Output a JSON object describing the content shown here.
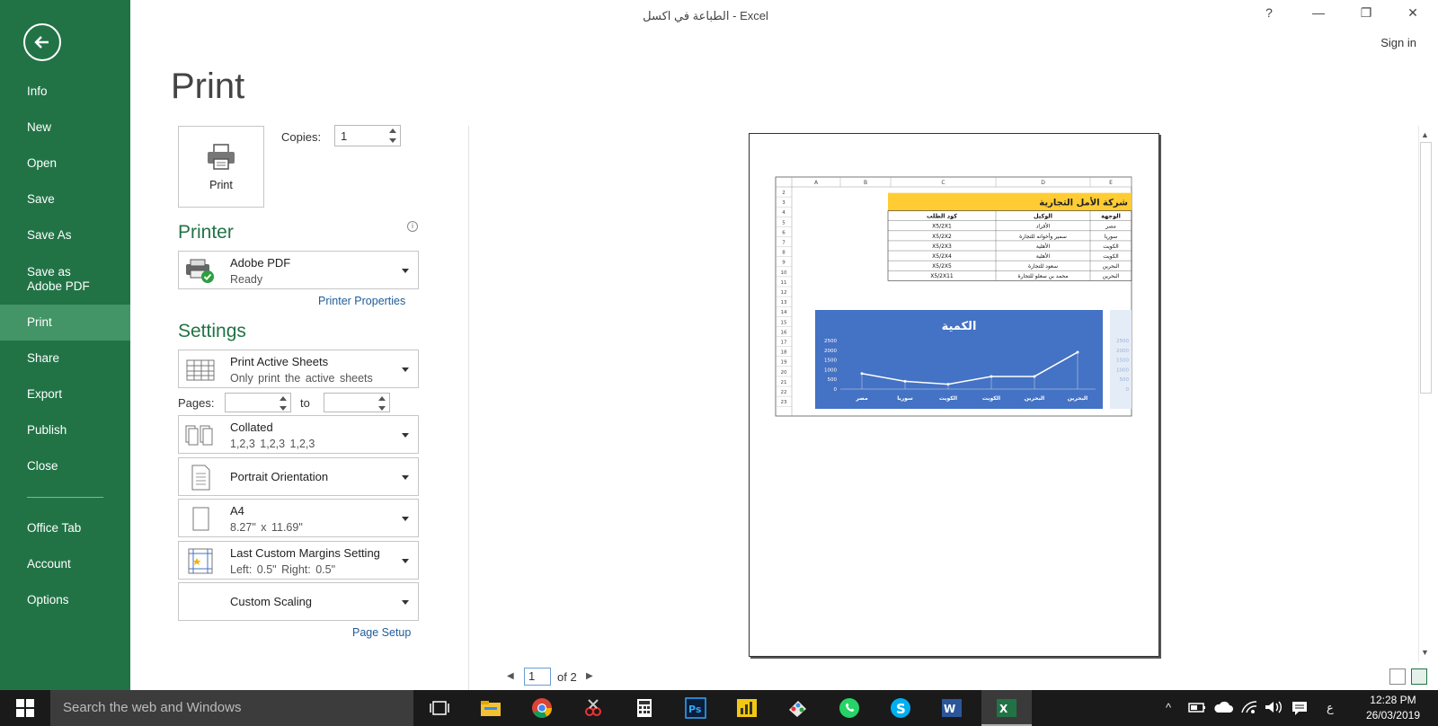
{
  "window": {
    "title": "الطباعة في اكسل - Excel",
    "help": "?",
    "minimize": "—",
    "restore": "❐",
    "close": "✕",
    "sign_in": "Sign in"
  },
  "sidebar": {
    "items": [
      {
        "label": "Info"
      },
      {
        "label": "New"
      },
      {
        "label": "Open"
      },
      {
        "label": "Save"
      },
      {
        "label": "Save As"
      },
      {
        "label": "Save as Adobe PDF"
      },
      {
        "label": "Print"
      },
      {
        "label": "Share"
      },
      {
        "label": "Export"
      },
      {
        "label": "Publish"
      },
      {
        "label": "Close"
      },
      {
        "label": "Office Tab"
      },
      {
        "label": "Account"
      },
      {
        "label": "Options"
      }
    ],
    "active": "Print"
  },
  "print": {
    "heading": "Print",
    "button_label": "Print",
    "copies_label": "Copies:",
    "copies_value": "1"
  },
  "printer": {
    "heading": "Printer",
    "name": "Adobe PDF",
    "status": "Ready",
    "properties_link": "Printer Properties"
  },
  "settings": {
    "heading": "Settings",
    "what": {
      "title": "Print Active Sheets",
      "subtitle": "Only print the active sheets"
    },
    "pages_label": "Pages:",
    "to_label": "to",
    "collation": {
      "title": "Collated",
      "subtitle": "1,2,3    1,2,3    1,2,3"
    },
    "orientation": {
      "title": "Portrait Orientation"
    },
    "paper": {
      "title": "A4",
      "subtitle": "8.27\" x 11.69\""
    },
    "margins": {
      "title": "Last Custom Margins Setting",
      "subtitle": "Left:  0.5\"    Right:  0.5\""
    },
    "scaling": {
      "title": "Custom Scaling"
    },
    "page_setup_link": "Page Setup"
  },
  "preview": {
    "current_page": "1",
    "of_pages": "of 2",
    "sheet": {
      "columns": [
        "A",
        "B",
        "C",
        "D",
        "E"
      ],
      "row_numbers": [
        "2",
        "3",
        "4",
        "5",
        "6",
        "7",
        "8",
        "9",
        "10",
        "11",
        "12",
        "13",
        "14",
        "15",
        "16",
        "17",
        "18",
        "19",
        "20",
        "21",
        "22",
        "23"
      ],
      "banner": "شركة الأمل التجارية",
      "headers": [
        "كود الطلب",
        "الوكيل",
        "الوجهة"
      ],
      "rows": [
        [
          "X5/2X1",
          "الأفراد",
          "مصر"
        ],
        [
          "X5/2X2",
          "سمير وأخوانه للتجارة",
          "سوريا"
        ],
        [
          "X5/2X3",
          "الأهلية",
          "الكويت"
        ],
        [
          "X5/2X4",
          "الأهلية",
          "الكويت"
        ],
        [
          "X5/2X5",
          "سعود للتجارة",
          "البحرين"
        ],
        [
          "X5/2X11",
          "محمد بن سعلو للتجارة",
          "البحرين"
        ]
      ]
    }
  },
  "chart_data": {
    "type": "line",
    "title": "الكمية",
    "categories": [
      "مصر",
      "سوريا",
      "الكويت",
      "الكويت",
      "البحرين",
      "البحرين"
    ],
    "series": [
      {
        "values": [
          800,
          400,
          250,
          650,
          650,
          1900
        ]
      }
    ],
    "yticks": [
      "2500",
      "2000",
      "1500",
      "1000",
      "500",
      "0"
    ],
    "ylim": [
      0,
      2500
    ],
    "background": "#4472c4",
    "line_color": "#ffffff"
  },
  "taskbar": {
    "search_placeholder": "Search the web and Windows",
    "time": "12:28 PM",
    "date": "26/03/2019",
    "lang": "ع"
  },
  "colors": {
    "sidebar": "#217346",
    "sidebar_active": "#439467",
    "accent_text": "#217346",
    "banner": "#ffcc33"
  }
}
